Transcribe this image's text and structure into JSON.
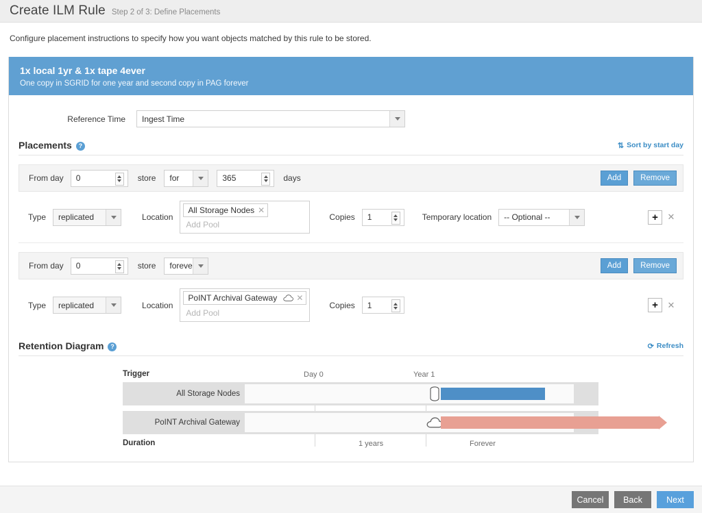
{
  "header": {
    "title": "Create ILM Rule",
    "step": "Step 2 of 3: Define Placements"
  },
  "intro": "Configure placement instructions to specify how you want objects matched by this rule to be stored.",
  "rule": {
    "name": "1x local 1yr & 1x tape 4ever",
    "description": "One copy in SGRID for one year and second copy in PAG forever"
  },
  "reference_time": {
    "label": "Reference Time",
    "value": "Ingest Time"
  },
  "placements": {
    "title": "Placements",
    "help_icon": "help-icon",
    "sort_link": "Sort by start day",
    "sort_icon": "sort-icon",
    "labels": {
      "from_day": "From day",
      "store": "store",
      "days": "days",
      "type": "Type",
      "location": "Location",
      "copies": "Copies",
      "temporary_location": "Temporary location",
      "add": "Add",
      "remove": "Remove",
      "add_pool_placeholder": "Add Pool",
      "plus_icon": "plus-icon",
      "close_icon": "close-icon"
    },
    "rows": [
      {
        "from_day": "0",
        "duration_mode": "for",
        "duration_value": "365",
        "type": "replicated",
        "pools": [
          {
            "name": "All Storage Nodes",
            "icon": ""
          }
        ],
        "copies": "1",
        "temporary_location": "-- Optional --",
        "has_temporary_location": true
      },
      {
        "from_day": "0",
        "duration_mode": "forever",
        "duration_value": "",
        "type": "replicated",
        "pools": [
          {
            "name": "PoINT Archival Gateway",
            "icon": "cloud-icon"
          }
        ],
        "copies": "1",
        "temporary_location": "",
        "has_temporary_location": false
      }
    ]
  },
  "retention_diagram": {
    "title": "Retention Diagram",
    "refresh_link": "Refresh",
    "refresh_icon": "refresh-icon",
    "trigger_label": "Trigger",
    "duration_label": "Duration",
    "time_ticks": [
      "Day 0",
      "Year 1"
    ],
    "duration_ticks": [
      "1 years",
      "Forever"
    ],
    "tracks": [
      {
        "name": "All Storage Nodes",
        "icon": "storage-node-icon",
        "color": "#4e8fc7",
        "start": "Day 0",
        "end": "Year 1",
        "arrow": false
      },
      {
        "name": "PoINT Archival Gateway",
        "icon": "cloud-icon",
        "color": "#e8a093",
        "start": "Day 0",
        "end": "Forever",
        "arrow": true
      }
    ]
  },
  "footer": {
    "cancel": "Cancel",
    "back": "Back",
    "next": "Next"
  }
}
